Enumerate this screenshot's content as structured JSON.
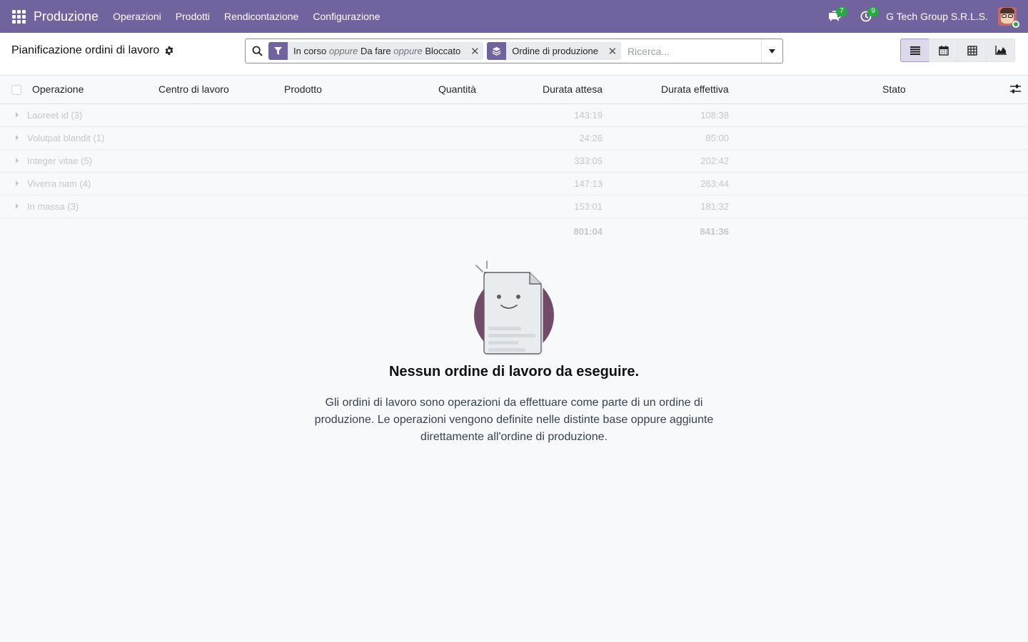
{
  "navbar": {
    "app_name": "Produzione",
    "menu": [
      "Operazioni",
      "Prodotti",
      "Rendicontazione",
      "Configurazione"
    ],
    "messages_count": "7",
    "activities_count": "9",
    "company": "G Tech Group S.R.L.S.",
    "color": "#71639e"
  },
  "control_panel": {
    "title": "Pianificazione ordini di lavoro",
    "search": {
      "placeholder": "Ricerca...",
      "facets": {
        "filter": {
          "v1": "In corso",
          "sep1": "oppure",
          "v2": "Da fare",
          "sep2": "oppure",
          "v3": "Bloccato"
        },
        "group": {
          "label": "Ordine di produzione"
        }
      }
    },
    "views": [
      "list-icon",
      "calendar-icon",
      "pivot-icon",
      "graph-icon"
    ],
    "active_view": "list"
  },
  "table": {
    "columns": {
      "operation": "Operazione",
      "workcenter": "Centro di lavoro",
      "product": "Prodotto",
      "quantity": "Quantità",
      "expected": "Durata attesa",
      "actual": "Durata effettiva",
      "state": "Stato"
    },
    "groups": [
      {
        "name": "Laoreet id (3)",
        "expected": "143:19",
        "actual": "108:38"
      },
      {
        "name": "Volutpat blandit (1)",
        "expected": "24:26",
        "actual": "85:00"
      },
      {
        "name": "Integer vitae (5)",
        "expected": "333:05",
        "actual": "202:42"
      },
      {
        "name": "Viverra nam (4)",
        "expected": "147:13",
        "actual": "263:44"
      },
      {
        "name": "In massa (3)",
        "expected": "153:01",
        "actual": "181:32"
      }
    ],
    "totals": {
      "expected": "801:04",
      "actual": "841:36"
    }
  },
  "empty_state": {
    "title": "Nessun ordine di lavoro da eseguire.",
    "text": "Gli ordini di lavoro sono operazioni da effettuare come parte di un ordine di produzione. Le operazioni vengono definite nelle distinte base oppure aggiunte direttamente all'ordine di produzione."
  }
}
